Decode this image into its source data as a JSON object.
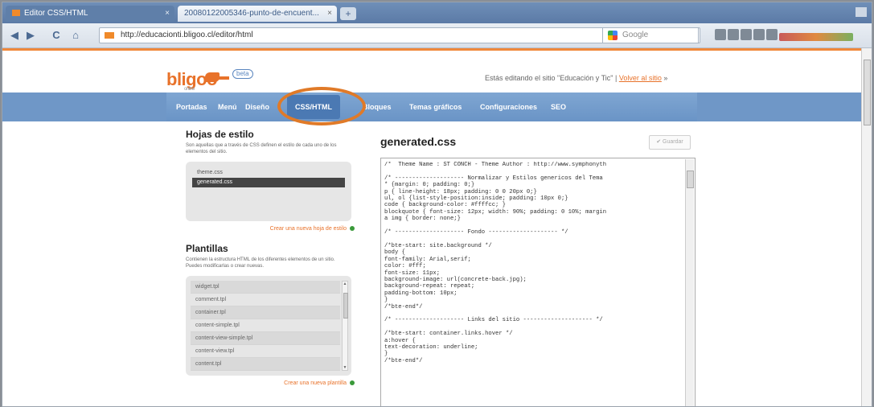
{
  "browser": {
    "tabs": [
      {
        "label": "Editor CSS/HTML"
      },
      {
        "label": "20080122005346-punto-de-encuent..."
      }
    ],
    "new_tab": "+",
    "url": "http://educacionti.bligoo.cl/editor/html",
    "search_placeholder": "Google",
    "nav": {
      "back": "◀",
      "forward": "▶",
      "reload": "C",
      "home": "⌂"
    }
  },
  "site": {
    "brand": "bligoo",
    "brand_sub": "online",
    "badge": "beta",
    "editing_text": "Estás editando el sitio \"Educación y Tic\" |",
    "return_link": "Volver al sitio",
    "return_arrow": " »",
    "menu": [
      "Portadas",
      "Menú",
      "Diseño",
      "CSS/HTML",
      "Bloques",
      "Temas gráficos",
      "Configuraciones",
      "SEO"
    ]
  },
  "stylesheets": {
    "title": "Hojas de estilo",
    "desc": "Son aquellas que a través de CSS definen el estilo de cada uno de los elementos del sitio.",
    "items": [
      "theme.css",
      "generated.css"
    ],
    "selected": 1,
    "add_link": "Crear una nueva hoja de estilo"
  },
  "templates": {
    "title": "Plantillas",
    "desc": "Contienen la estructura HTML de los diferentes elementos de un sitio. Puedes modificarlas o crear nuevas.",
    "items": [
      "widget.tpl",
      "comment.tpl",
      "container.tpl",
      "content-simple.tpl",
      "content-view-simple.tpl",
      "content-view.tpl",
      "content.tpl"
    ],
    "add_link": "Crear una nueva plantilla"
  },
  "editor": {
    "file_name": "generated.css",
    "save_label": "✔ Guardar",
    "code_lines": [
      "/*  Theme Name : ST CONCH - Theme Author : http://www.symphonyth",
      "",
      "/* -------------------- Normalizar y Estilos genericos del Tema",
      "* {margin: 0; padding: 0;}",
      "p { line-height: 18px; padding: 0 0 20px 0;}",
      "ul, ol {list-style-position:inside; padding: 10px 0;}",
      "code { background-color: #ffffcc; }",
      "blockquote { font-size: 12px; width: 90%; padding: 0 10%; margin",
      "a img { border: none;}",
      "",
      "/* -------------------- Fondo -------------------- */",
      "",
      "/*bte-start: site.background */",
      "body {",
      "font-family: Arial,serif;",
      "color: #fff;",
      "font-size: 11px;",
      "background-image: url(concrete-back.jpg);",
      "background-repeat: repeat;",
      "padding-bottom: 10px;",
      "}",
      "/*bte-end*/",
      "",
      "/* -------------------- Links del sitio -------------------- */",
      "",
      "/*bte-start: container.links.hover */",
      "a:hover {",
      "text-decoration: underline;",
      "}",
      "/*bte-end*/"
    ]
  },
  "colors": {
    "accent": "#e8722a",
    "menu": "#6f97c7",
    "menu_active": "#4b79b3"
  }
}
